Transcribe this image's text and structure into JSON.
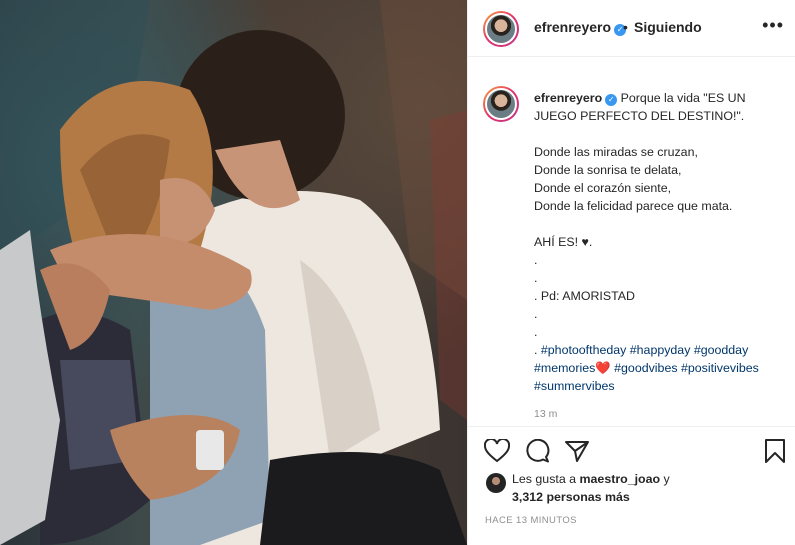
{
  "post": {
    "username": "efrenreyero",
    "verified_badge": "✓",
    "separator": "•",
    "follow_status": "Siguiendo",
    "more_icon": "•••"
  },
  "caption": {
    "username": "efrenreyero",
    "lines": [
      "Porque la vida \"ES UN JUEGO PERFECTO DEL DESTINO!\".",
      "",
      "Donde las miradas se cruzan,",
      "Donde la sonrisa te delata,",
      "Donde el corazón siente,",
      "Donde la felicidad parece que mata.",
      "",
      "AHÍ ES! ♥.",
      ".",
      ".",
      ". Pd: AMORISTAD",
      ".",
      "."
    ],
    "hashtags_line1_prefix": ". ",
    "hashtags": "#photooftheday #happyday #goodday #memories❤️ #goodvibes #positivevibes #summervibes",
    "relative_time": "13 m"
  },
  "likes": {
    "prefix": "Les gusta a ",
    "user": "maestro_joao",
    "suffix": " y",
    "others": "3,312 personas más"
  },
  "timestamp": "HACE 13 MINUTOS",
  "icons": [
    "heart-icon",
    "comment-icon",
    "share-icon",
    "bookmark-icon"
  ],
  "colors": {
    "link": "#00376b",
    "verified": "#3897f0",
    "muted": "#8e8e8e"
  }
}
